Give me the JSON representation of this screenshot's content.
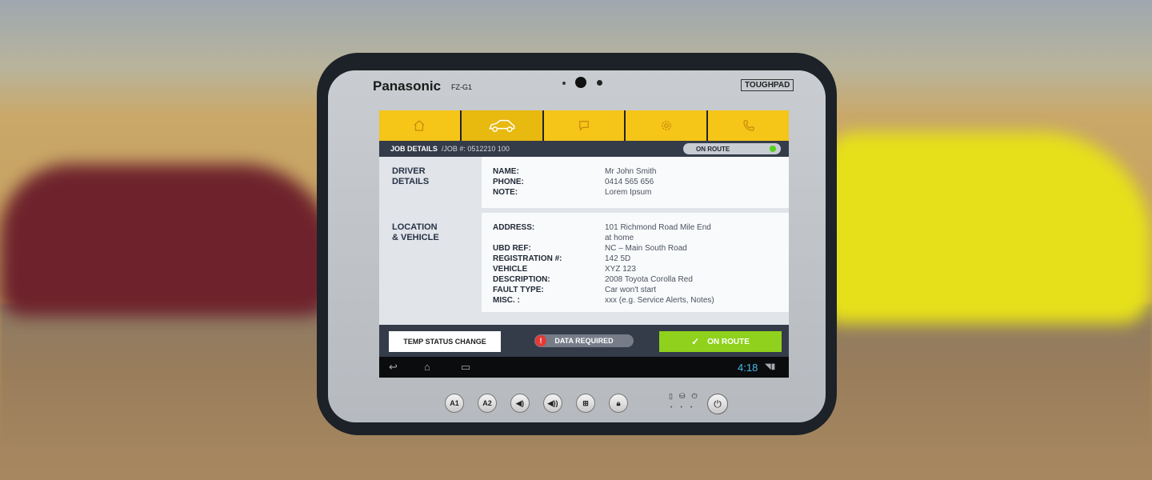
{
  "device": {
    "brand": "Panasonic",
    "model": "FZ-G1",
    "series": "TOUGHPAD"
  },
  "tabs": [
    {
      "icon": "home-icon",
      "active": false
    },
    {
      "icon": "car-icon",
      "active": true
    },
    {
      "icon": "chat-icon",
      "active": false
    },
    {
      "icon": "gear-icon",
      "active": false
    },
    {
      "icon": "phone-icon",
      "active": false
    }
  ],
  "job_bar": {
    "title": "JOB DETAILS",
    "job_number": "/JOB #: 0512210 100",
    "status": "ON ROUTE",
    "status_color": "#57d11b"
  },
  "driver_details": {
    "label_line1": "DRIVER",
    "label_line2": "DETAILS",
    "fields": [
      {
        "key": "NAME:",
        "value": "Mr John Smith"
      },
      {
        "key": "PHONE:",
        "value": "0414 565 656"
      },
      {
        "key": "NOTE:",
        "value": "Lorem Ipsum"
      }
    ]
  },
  "location_vehicle": {
    "label_line1": "LOCATION",
    "label_line2": "& VEHICLE",
    "address_key": "ADDRESS:",
    "address_line1": "101 Richmond  Road  Mile End",
    "address_line2": "at home",
    "fields": [
      {
        "key": "UBD REF:",
        "value": "NC – Main South Road"
      },
      {
        "key": "REGISTRATION #:",
        "value": "142 5D"
      },
      {
        "key": "VEHICLE",
        "value": "XYZ 123"
      },
      {
        "key": "DESCRIPTION:",
        "value": "2008 Toyota Corolla Red"
      },
      {
        "key": "FAULT TYPE:",
        "value": "Car won't start"
      },
      {
        "key": "MISC. :",
        "value": "xxx (e.g. Service Alerts, Notes)"
      }
    ]
  },
  "actions": {
    "temp_status": "TEMP STATUS CHANGE",
    "data_required": "DATA REQUIRED",
    "alert_glyph": "!",
    "on_route": "ON ROUTE",
    "on_route_color": "#8fd11c"
  },
  "system_bar": {
    "time": "4:18"
  },
  "hardware_buttons": [
    {
      "label": "A1"
    },
    {
      "label": "A2"
    }
  ]
}
